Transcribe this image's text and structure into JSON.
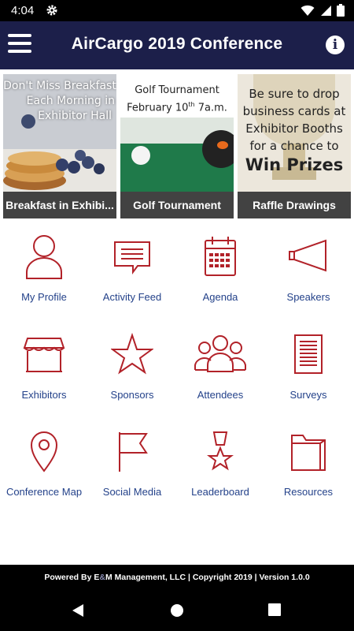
{
  "status_bar": {
    "time": "4:04"
  },
  "app_bar": {
    "title": "AirCargo 2019 Conference"
  },
  "banners": [
    {
      "overlay_lines": [
        "Don't Miss Breakfast",
        "Each Morning in",
        "Exhibitor Hall"
      ],
      "caption": "Breakfast in Exhibi..."
    },
    {
      "overlay_lines": [
        "Golf Tournament",
        "February 10",
        "th",
        " 7a.m."
      ],
      "caption": "Golf Tournament"
    },
    {
      "overlay_lines": [
        "Be sure to drop",
        "business cards at",
        "Exhibitor Booths",
        "for a chance to",
        "Win Prizes"
      ],
      "caption": "Raffle Drawings"
    }
  ],
  "tiles": [
    {
      "label": "My Profile",
      "icon": "person-icon"
    },
    {
      "label": "Activity Feed",
      "icon": "chat-bubble-icon"
    },
    {
      "label": "Agenda",
      "icon": "calendar-icon"
    },
    {
      "label": "Speakers",
      "icon": "megaphone-icon"
    },
    {
      "label": "Exhibitors",
      "icon": "storefront-icon"
    },
    {
      "label": "Sponsors",
      "icon": "star-icon"
    },
    {
      "label": "Attendees",
      "icon": "group-icon"
    },
    {
      "label": "Surveys",
      "icon": "document-icon"
    },
    {
      "label": "Conference Map",
      "icon": "map-pin-icon"
    },
    {
      "label": "Social Media",
      "icon": "flag-icon"
    },
    {
      "label": "Leaderboard",
      "icon": "medal-icon"
    },
    {
      "label": "Resources",
      "icon": "folder-icon"
    }
  ],
  "footer": {
    "prefix": "Powered By ",
    "brand_e": "E",
    "brand_amp": "&",
    "brand_m": "M",
    "suffix": " Management, LLC | Copyright 2019 | Version 1.0.0"
  },
  "colors": {
    "app_bar": "#1c1f4a",
    "icon": "#b22229",
    "label": "#24428a"
  }
}
